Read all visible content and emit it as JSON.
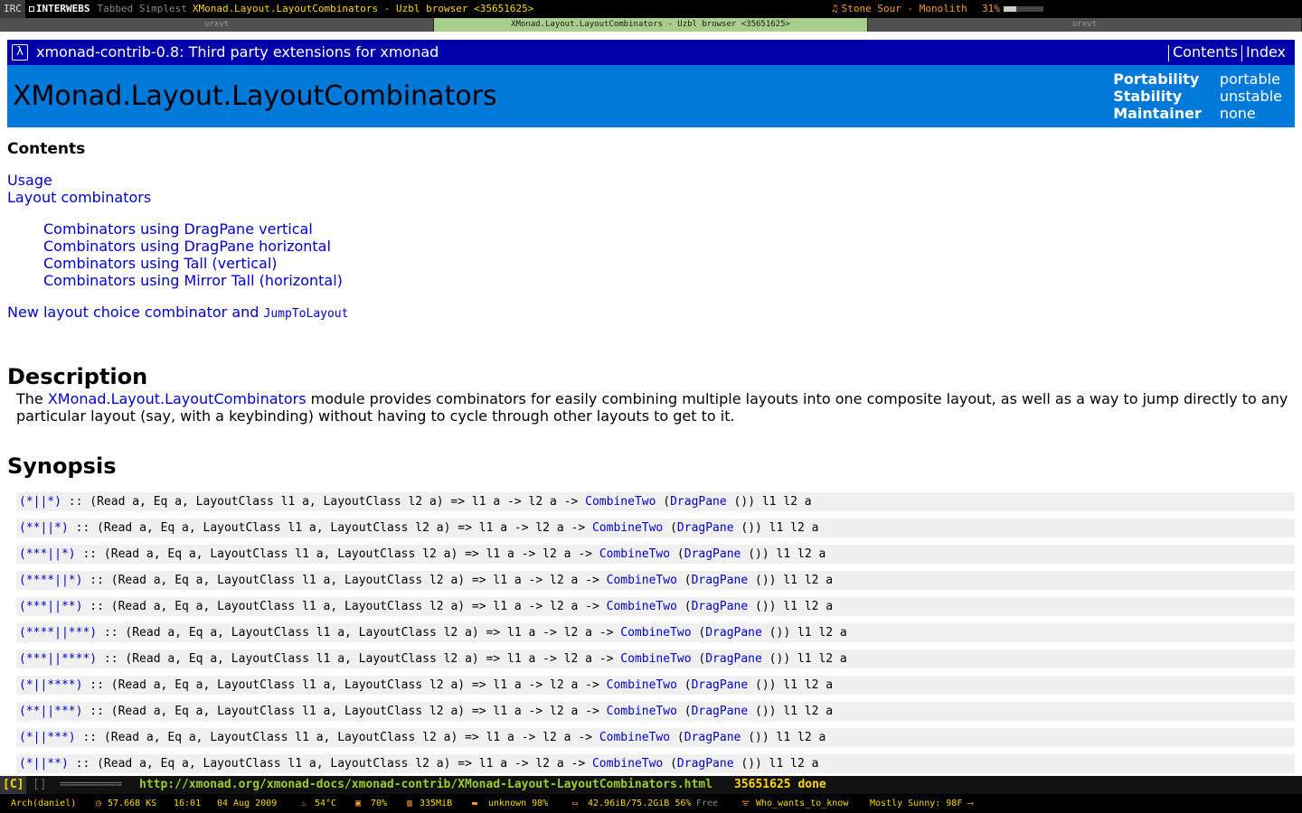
{
  "topbar": {
    "workspaces": [
      "IRC",
      "INTERWEBS"
    ],
    "layout": "Tabbed Simplest",
    "window_title": "XMonad.Layout.LayoutCombinators - Uzbl browser <35651625>",
    "music_icon": "music-note-icon",
    "music": "Stone Sour - Monolith",
    "volume": "31%",
    "volume_level": 0.31
  },
  "tabs": [
    {
      "label": "urxvt",
      "active": false
    },
    {
      "label": "XMonad.Layout.LayoutCombinators - Uzbl browser <35651625>",
      "active": true
    },
    {
      "label": "urxvt",
      "active": false
    }
  ],
  "header": {
    "package": "xmonad-contrib-0.8: Third party extensions for xmonad",
    "links": [
      "Contents",
      "Index"
    ],
    "module": "XMonad.Layout.LayoutCombinators",
    "info": [
      {
        "key": "Portability",
        "value": "portable"
      },
      {
        "key": "Stability",
        "value": "unstable"
      },
      {
        "key": "Maintainer",
        "value": "none"
      }
    ]
  },
  "contents": {
    "heading": "Contents",
    "items": {
      "usage": "Usage",
      "layout_combinators": "Layout combinators",
      "sub": [
        "Combinators using DragPane vertical",
        "Combinators using DragPane horizontal",
        "Combinators using Tall (vertical)",
        "Combinators using Mirror Tall (horizontal)"
      ],
      "new_layout": "New layout choice combinator and ",
      "new_layout_code": "JumpToLayout"
    }
  },
  "description": {
    "heading": "Description",
    "prefix": "The ",
    "link": "XMonad.Layout.LayoutCombinators",
    "text": " module provides combinators for easily combining multiple layouts into one composite layout, as well as a way to jump directly to any particular layout (say, with a keybinding) without having to cycle through other layouts to get to it."
  },
  "synopsis": {
    "heading": "Synopsis",
    "sig_middle": " :: (Read a, Eq a, LayoutClass l1 a, LayoutClass l2 a) => l1 a -> l2 a -> ",
    "combine": "CombineTwo",
    "open": " (",
    "dragpane": "DragPane",
    "tail": " ()) l1 l2 a",
    "ops": [
      "(*||*)",
      "(**||*)",
      "(***||*)",
      "(****||*)",
      "(***||**)",
      "(****||***)",
      "(***||****)",
      "(*||****)",
      "(**||***)",
      "(*||***)",
      "(*||**)"
    ]
  },
  "status": {
    "mode": "[C]",
    "brackets": "[]",
    "progress": "==========",
    "url": "http://xmonad.org/xmonad-docs/xmonad-contrib/XMonad-Layout-LayoutCombinators.html",
    "pid": "35651625",
    "state": "done"
  },
  "bottombar": {
    "user": "Arch(daniel)",
    "speed": "57.668 KS",
    "time": "16:01",
    "date": "04 Aug 2009",
    "temp": "54°C",
    "cpu": "70%",
    "mem": "335MiB",
    "battery": "unknown 98%",
    "disk": "42.96iB/75.2GiB 56%",
    "disk_free": "Free",
    "wifi": "Who_wants_to_know",
    "weather": "Mostly Sunny: 98F"
  }
}
